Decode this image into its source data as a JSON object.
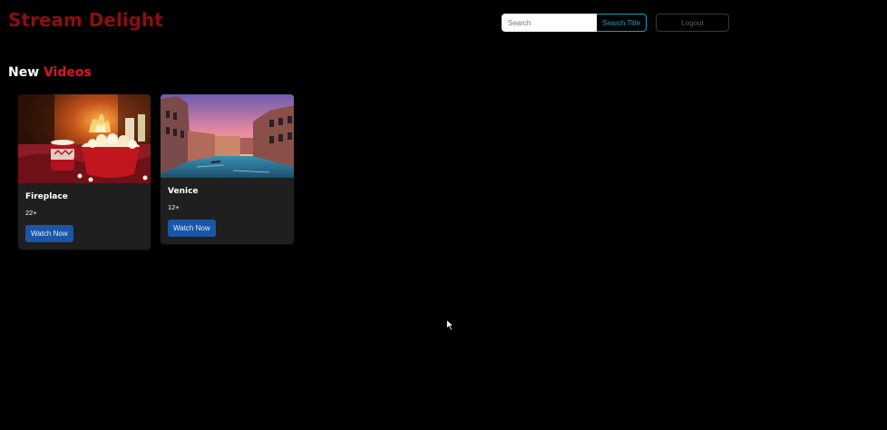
{
  "header": {
    "brand": "Stream Delight",
    "search_placeholder": "Search",
    "search_button": "Search Title",
    "logout": "Logout"
  },
  "section": {
    "title_white": "New",
    "title_red": "Videos"
  },
  "videos": [
    {
      "title": "Fireplace",
      "rating": "22+",
      "button": "Watch Now",
      "thumbnail": "fireplace-popcorn-thumbnail"
    },
    {
      "title": "Venice",
      "rating": "12+",
      "button": "Watch Now",
      "thumbnail": "venice-canal-thumbnail"
    }
  ],
  "colors": {
    "background": "#000000",
    "brand": "#8b0e10",
    "accent_red": "#d9161b",
    "search_button": "#17a2b8",
    "watch_button": "#1a56a8",
    "card": "#1f1f1f"
  }
}
